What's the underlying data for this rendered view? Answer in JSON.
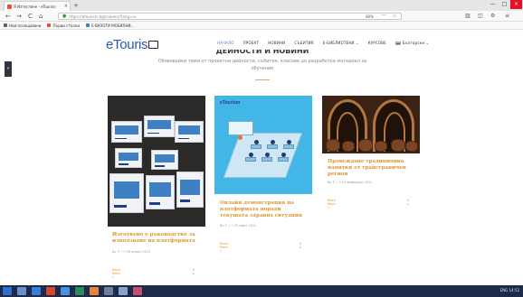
{
  "browser": {
    "tab_title": "Я Изтегляне - eTourisn",
    "tab_close": "×",
    "new_tab": "+",
    "nav_back": "←",
    "nav_forward": "→",
    "nav_reload": "C",
    "nav_home": "⌂",
    "url": "https://etourism.bg/column/?lang=ru",
    "zoom": "80%",
    "overflow": "···",
    "window_min": "—",
    "window_max": "□",
    "window_close": "×"
  },
  "bookmarks": [
    {
      "label": "Най-посещавани",
      "color": "#5f6368"
    },
    {
      "label": "Първи стъпки",
      "color": "#e4523b"
    },
    {
      "label": "Е-ВИЗОТИ МОБИЛНИ...",
      "color": "#3b7ddd"
    }
  ],
  "site": {
    "logo_text": "eTouris",
    "menu": [
      {
        "label": "НАЧАЛО",
        "active": true
      },
      {
        "label": "ПРОЕКТ",
        "active": false
      },
      {
        "label": "НОВИНИ",
        "active": false
      },
      {
        "label": "СЪБИТИЯ",
        "active": false
      },
      {
        "label": "Е-БИБЛИОТЕКИ ⌄",
        "active": false
      },
      {
        "label": "КУРСОВЕ",
        "active": false
      }
    ],
    "language": "Български ⌄",
    "section_title": "ДЕЙНОСТИ И НОВИНИ",
    "section_subtitle": "Обявявайки теми от проектни дейности, събития, класове до разработка материал за обучение",
    "side_toggle": "»"
  },
  "cards": [
    {
      "title": "Изготвено е ръководство за използване на платформата",
      "meta": "By ✎ / ⏱ 29 април 2021",
      "more": "Read More »",
      "comments": "0 ▸"
    },
    {
      "image_logo": "eTourism",
      "title": "Онлайн демонстрация на платформата поради текущата здравна ситуация",
      "meta": "By ✎ / ⏱ 25 март 2021",
      "more": "Read More »",
      "comments": "0 ▸"
    },
    {
      "title": "Провеждане традиционна напитки от трансграничен регион",
      "meta": "By ✎ / ⏱ 19 февруари 2021",
      "more": "Read More »",
      "comments": "0 ▸"
    }
  ],
  "taskbar": {
    "clock": "ENG  14:52"
  }
}
